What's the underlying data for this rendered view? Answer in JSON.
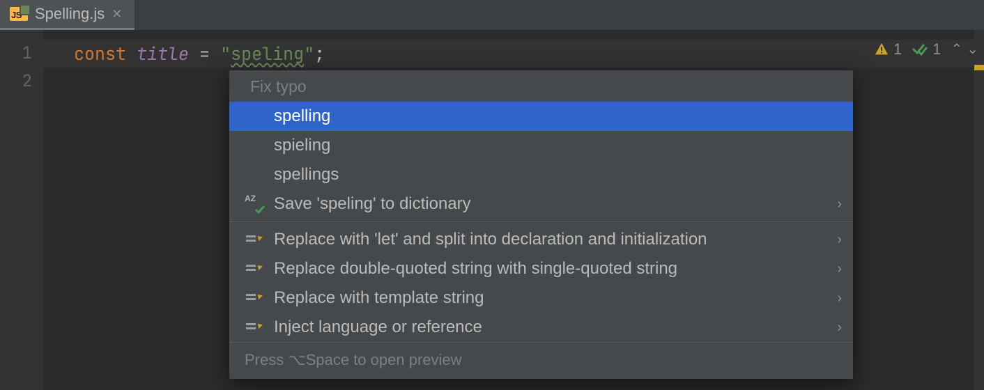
{
  "tab": {
    "filename": "Spelling.js",
    "icon_text": "JS"
  },
  "gutter": {
    "lines": [
      "1",
      "2"
    ]
  },
  "code": {
    "keyword": "const",
    "ident": "title",
    "eq": " = ",
    "quote_open": "\"",
    "string_inner": "speling",
    "quote_close": "\"",
    "semicolon": ";"
  },
  "inspections": {
    "warnings_count": "1",
    "weak_count": "1"
  },
  "popup": {
    "header": "Fix typo",
    "suggestions": [
      "spelling",
      "spieling",
      "spellings"
    ],
    "save_dict": "Save 'speling' to dictionary",
    "actions": [
      "Replace with 'let' and split into declaration and initialization",
      "Replace double-quoted string with single-quoted string",
      "Replace with template string",
      "Inject language or reference"
    ],
    "footer": "Press ⌥Space to open preview"
  }
}
